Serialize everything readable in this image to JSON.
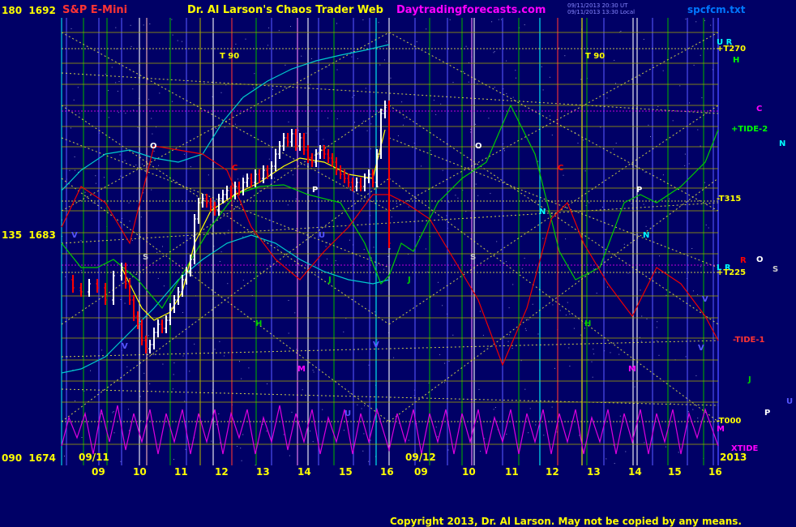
{
  "header": {
    "symbol": "S&P E-Mini",
    "title": "Dr. Al Larson's Chaos Trader Web",
    "site": "Daytradingforecasts.com",
    "file": "spcfcm.txt",
    "timestamp_1": "09/11/2013 20:30 UT",
    "timestamp_2": "09/11/2013 13:30 Local"
  },
  "footer": {
    "copyright": "Copyright 2013, Dr. Al Larson. May not be copied by any means."
  },
  "colors": {
    "background": "#000066",
    "price_up": "#ffffff",
    "price_down": "#ff0000",
    "grid_blue": "#5555ff",
    "grid_green": "#00aa00",
    "grid_yellow": "#aaaa00",
    "yellow_dotted": "#ffff44",
    "magenta": "#ff00ff",
    "cyan": "#00ffff",
    "green_line": "#00cc00",
    "red_line": "#ee0000"
  },
  "chart_data": {
    "type": "line",
    "title": "S&P E-Mini",
    "y_axis": [
      {
        "angle": "180",
        "price": "1692"
      },
      {
        "angle": "135",
        "price": "1683"
      },
      {
        "angle": "090",
        "price": "1674"
      }
    ],
    "ylim": [
      1674,
      1692
    ],
    "date_labels": [
      "09/11",
      "09/12",
      "2013"
    ],
    "x_ticks": [
      "09",
      "10",
      "11",
      "12",
      "13",
      "14",
      "15",
      "16",
      "09",
      "10",
      "11",
      "12",
      "13",
      "14",
      "15",
      "16"
    ],
    "right_labels": [
      {
        "text": "U R",
        "color": "#00ffff"
      },
      {
        "text": "+T270",
        "color": "#ffff00"
      },
      {
        "text": "H",
        "color": "#00ff00"
      },
      {
        "text": "C",
        "color": "#ff00ff"
      },
      {
        "text": "+TIDE-2",
        "color": "#00ff00"
      },
      {
        "text": "N",
        "color": "#00ffff"
      },
      {
        "text": "-T315",
        "color": "#ffff00"
      },
      {
        "text": "R",
        "color": "#ff0000"
      },
      {
        "text": "O",
        "color": "#ffffff"
      },
      {
        "text": "S",
        "color": "#cccccc"
      },
      {
        "text": "L R",
        "color": "#00ffff"
      },
      {
        "text": "+T225",
        "color": "#ffff00"
      },
      {
        "text": "V",
        "color": "#5555ff"
      },
      {
        "text": "-TIDE-1",
        "color": "#ff3333"
      },
      {
        "text": "V",
        "color": "#5555ff"
      },
      {
        "text": "J",
        "color": "#00cc00"
      },
      {
        "text": "U",
        "color": "#5555ff"
      },
      {
        "text": "P",
        "color": "#ffffff"
      },
      {
        "text": "-T000",
        "color": "#ffff00"
      },
      {
        "text": "M",
        "color": "#ff00ff"
      },
      {
        "text": "XTIDE",
        "color": "#ff00ff"
      }
    ],
    "in_chart_labels": [
      {
        "text": "T  90",
        "color": "#ffff00"
      },
      {
        "text": "T  90",
        "color": "#ffff00"
      },
      {
        "text": "O",
        "color": "#ffffff"
      },
      {
        "text": "O",
        "color": "#ffffff"
      },
      {
        "text": "C",
        "color": "#ff0000"
      },
      {
        "text": "C",
        "color": "#ff0000"
      },
      {
        "text": "P",
        "color": "#ffffff"
      },
      {
        "text": "P",
        "color": "#ffffff"
      },
      {
        "text": "S",
        "color": "#cccccc"
      },
      {
        "text": "S",
        "color": "#cccccc"
      },
      {
        "text": "V",
        "color": "#5555ff"
      },
      {
        "text": "V",
        "color": "#5555ff"
      },
      {
        "text": "N",
        "color": "#00ffff"
      },
      {
        "text": "N",
        "color": "#00ffff"
      },
      {
        "text": "J",
        "color": "#00cc00"
      },
      {
        "text": "J",
        "color": "#00cc00"
      },
      {
        "text": "H",
        "color": "#00cc00"
      },
      {
        "text": "H",
        "color": "#00cc00"
      },
      {
        "text": "M",
        "color": "#ff00ff"
      },
      {
        "text": "M",
        "color": "#ff00ff"
      },
      {
        "text": "V",
        "color": "#5555ff"
      },
      {
        "text": "U",
        "color": "#5555ff"
      },
      {
        "text": "U",
        "color": "#5555ff"
      }
    ],
    "series": [
      {
        "name": "price",
        "color": "#ffffff"
      },
      {
        "name": "green line",
        "color": "#00cc00"
      },
      {
        "name": "red line",
        "color": "#ee0000"
      },
      {
        "name": "cyan line",
        "color": "#00cccc"
      },
      {
        "name": "magenta line",
        "color": "#dd00dd"
      }
    ]
  }
}
